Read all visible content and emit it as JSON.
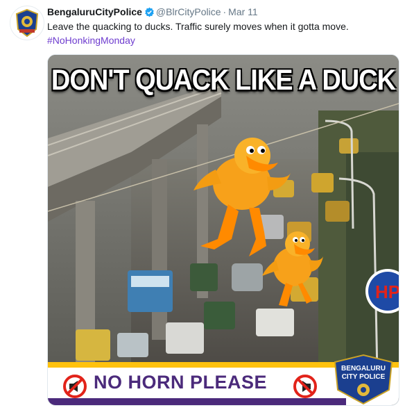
{
  "tweet": {
    "name": "BengaluruCityPolice",
    "handle": "@BlrCityPolice",
    "dot": "·",
    "date": "Mar 11",
    "text": "Leave the quacking to ducks. Traffic surely moves when it gotta move.",
    "hashtag": "#NoHonkingMonday"
  },
  "media": {
    "headline": "DON'T QUACK LIKE A DUCK",
    "banner": "NO HORN PLEASE",
    "logo_lines": [
      "BENGALURU",
      "CITY POLICE"
    ],
    "station_sign": "HP"
  },
  "colors": {
    "verified": "#1da1f2",
    "hashtag": "#6e3ccf",
    "banner_text": "#4b2a7b",
    "banner_stripe": "#ffc20e",
    "no_horn_red": "#e2231a",
    "duck": "#f7a11a"
  },
  "icons": [
    "verified-badge-icon",
    "no-horn-icon",
    "police-logo"
  ]
}
